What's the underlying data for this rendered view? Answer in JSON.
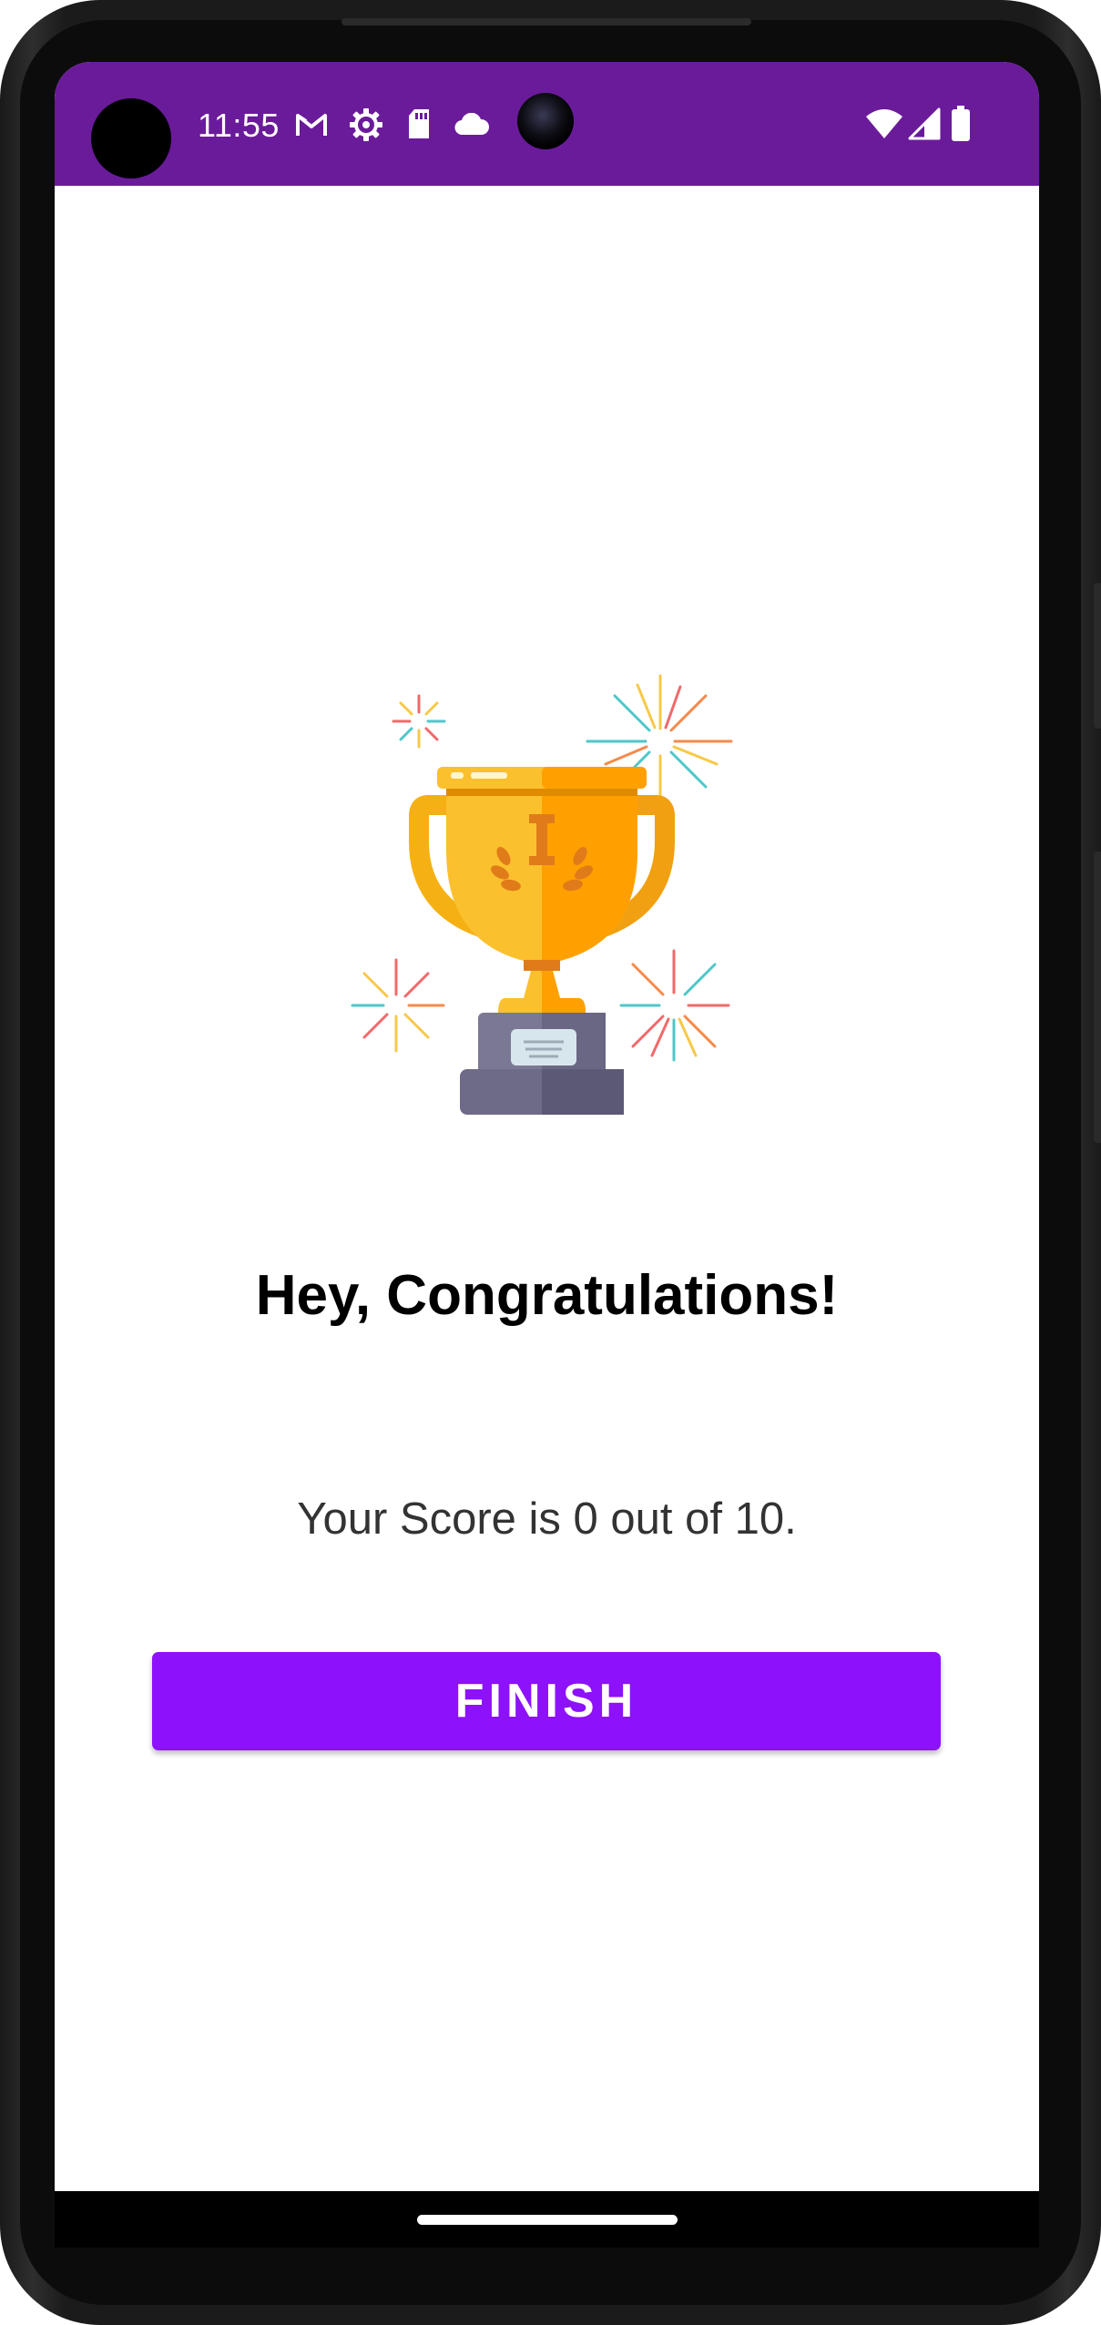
{
  "status_bar": {
    "time": "11:55",
    "left_icons": [
      "gmail-icon",
      "settings-icon",
      "sd-card-icon",
      "cloud-icon"
    ],
    "right_icons": [
      "wifi-icon",
      "signal-icon",
      "battery-icon"
    ],
    "background": "#6a1b9a"
  },
  "result": {
    "image": "trophy-with-fireworks",
    "headline": "Hey, Congratulations!",
    "score_text": "Your Score is 0 out of 10.",
    "finish_label": "FINISH",
    "button_color": "#8d11fa"
  }
}
